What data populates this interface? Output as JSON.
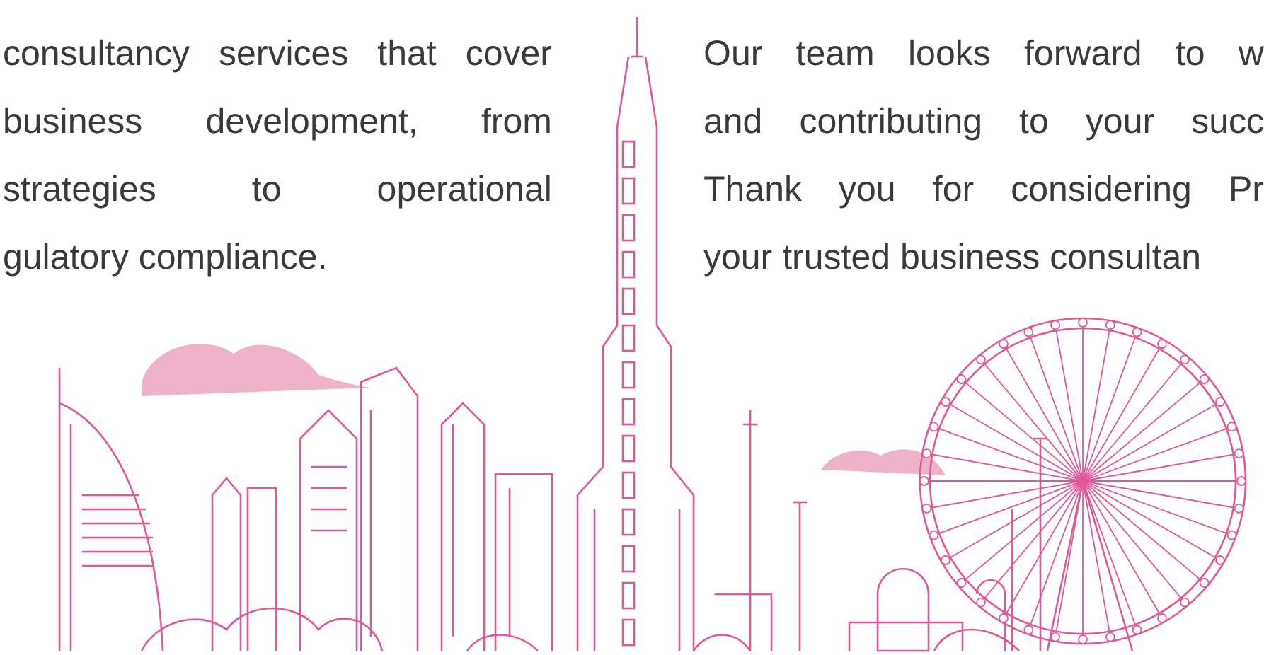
{
  "left_paragraph": {
    "lines": [
      "consultancy services that cover",
      "business development, from",
      "strategies to operational",
      "gulatory compliance."
    ]
  },
  "right_paragraph": {
    "lines": [
      "Our team looks forward to w",
      "and contributing to your succ",
      "Thank you for considering Pr",
      "your trusted business consultan"
    ]
  }
}
